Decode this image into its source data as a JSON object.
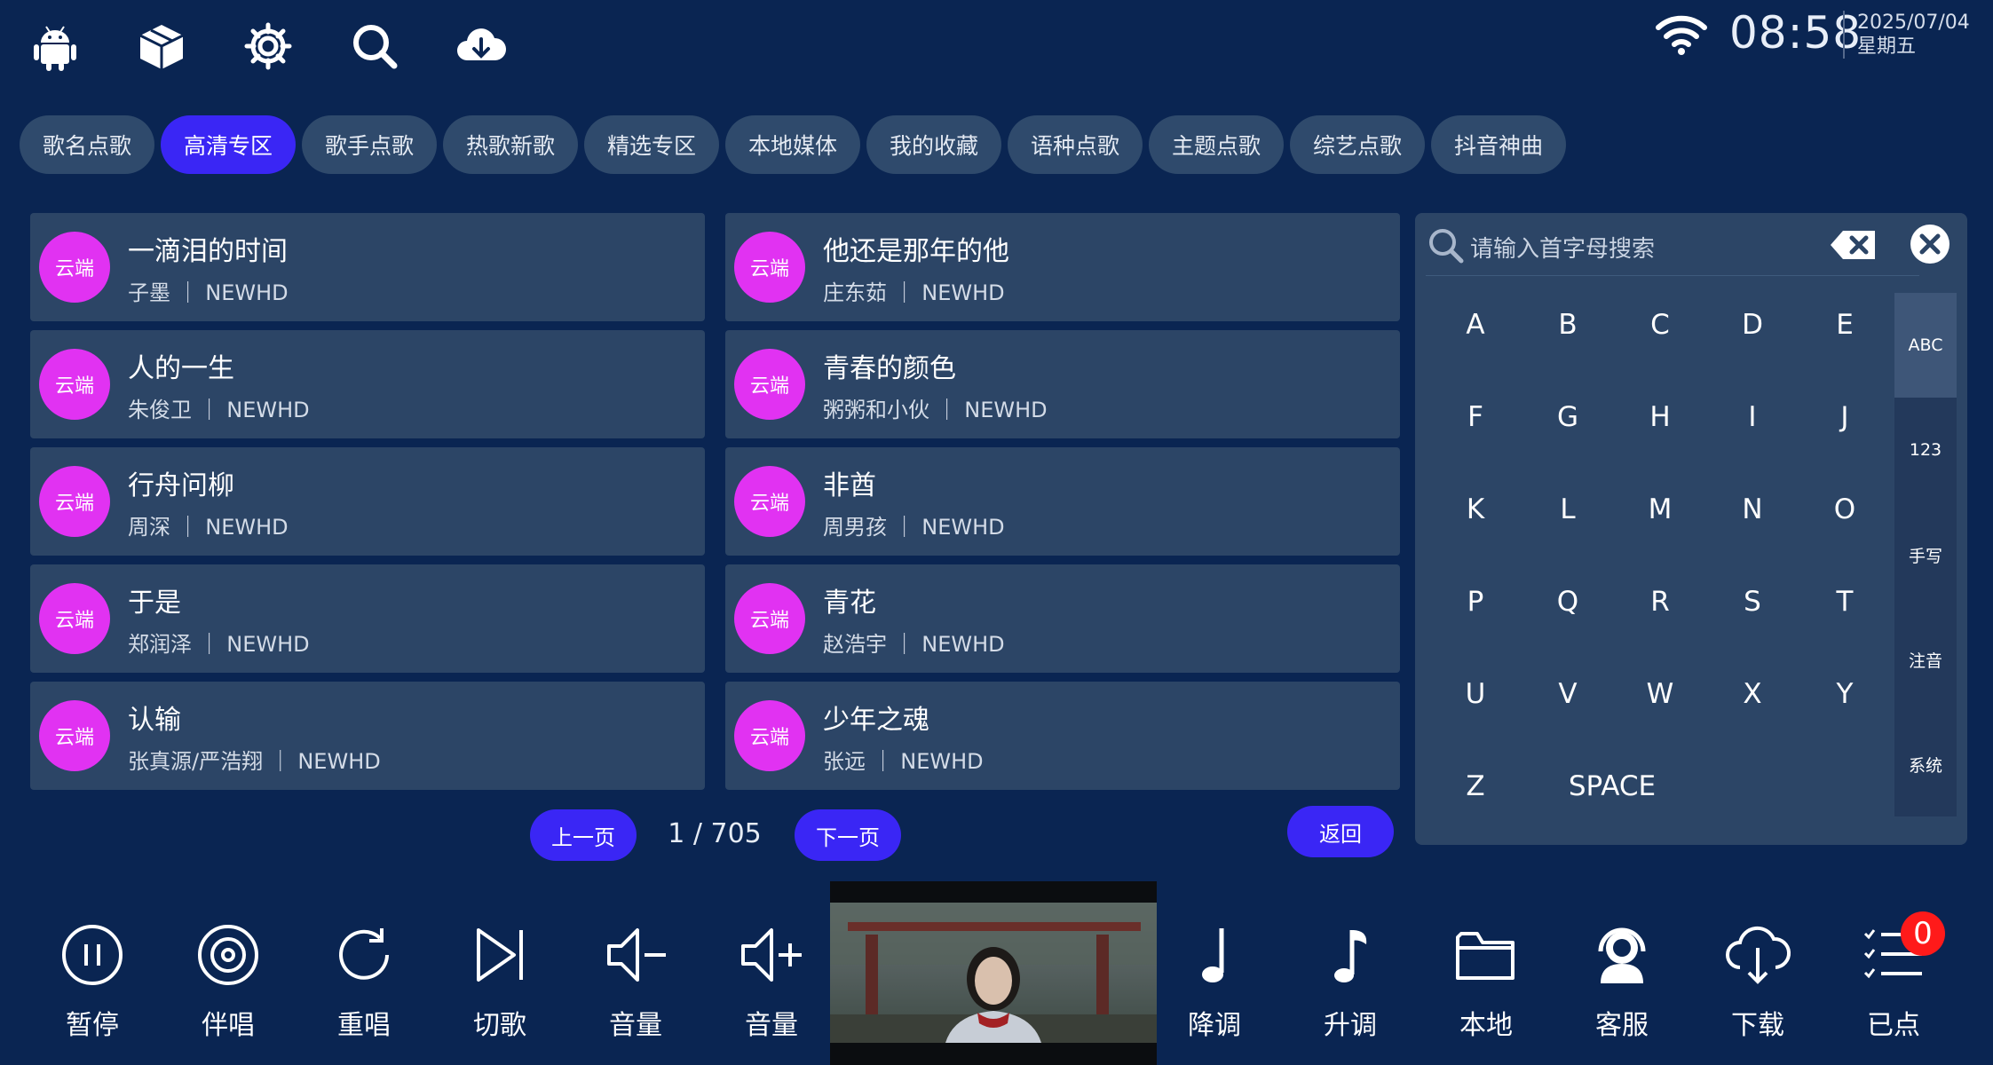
{
  "status_bar": {
    "time": "08:58",
    "date": "2025/07/04",
    "weekday": "星期五",
    "icons": [
      "android-icon",
      "box-icon",
      "gear-icon",
      "search-icon",
      "cloud-download-icon",
      "wifi-icon"
    ]
  },
  "tabs": [
    {
      "label": "歌名点歌",
      "active": false
    },
    {
      "label": "高清专区",
      "active": true
    },
    {
      "label": "歌手点歌",
      "active": false
    },
    {
      "label": "热歌新歌",
      "active": false
    },
    {
      "label": "精选专区",
      "active": false
    },
    {
      "label": "本地媒体",
      "active": false
    },
    {
      "label": "我的收藏",
      "active": false
    },
    {
      "label": "语种点歌",
      "active": false
    },
    {
      "label": "主题点歌",
      "active": false
    },
    {
      "label": "综艺点歌",
      "active": false
    },
    {
      "label": "抖音神曲",
      "active": false
    }
  ],
  "songs": [
    {
      "badge": "云端",
      "title": "一滴泪的时间",
      "subtitle": "子墨 ｜ NEWHD"
    },
    {
      "badge": "云端",
      "title": "他还是那年的他",
      "subtitle": "庄东茹 ｜ NEWHD"
    },
    {
      "badge": "云端",
      "title": "人的一生",
      "subtitle": "朱俊卫 ｜ NEWHD"
    },
    {
      "badge": "云端",
      "title": "青春的颜色",
      "subtitle": "粥粥和小伙 ｜ NEWHD"
    },
    {
      "badge": "云端",
      "title": "行舟问柳",
      "subtitle": "周深 ｜ NEWHD"
    },
    {
      "badge": "云端",
      "title": "非酋",
      "subtitle": "周男孩 ｜ NEWHD"
    },
    {
      "badge": "云端",
      "title": "于是",
      "subtitle": "郑润泽 ｜ NEWHD"
    },
    {
      "badge": "云端",
      "title": "青花",
      "subtitle": "赵浩宇 ｜ NEWHD"
    },
    {
      "badge": "云端",
      "title": "认输",
      "subtitle": "张真源/严浩翔 ｜ NEWHD"
    },
    {
      "badge": "云端",
      "title": "少年之魂",
      "subtitle": "张远 ｜ NEWHD"
    }
  ],
  "pagination": {
    "prev_label": "上一页",
    "next_label": "下一页",
    "page_text": "1 / 705",
    "back_label": "返回"
  },
  "keyboard": {
    "placeholder": "请输入首字母搜索",
    "keys": [
      "A",
      "B",
      "C",
      "D",
      "E",
      "F",
      "G",
      "H",
      "I",
      "J",
      "K",
      "L",
      "M",
      "N",
      "O",
      "P",
      "Q",
      "R",
      "S",
      "T",
      "U",
      "V",
      "W",
      "X",
      "Y",
      "Z"
    ],
    "space_label": "SPACE",
    "modes": [
      {
        "label": "ABC",
        "active": true
      },
      {
        "label": "123",
        "active": false
      },
      {
        "label": "手写",
        "active": false
      },
      {
        "label": "注音",
        "active": false
      },
      {
        "label": "系统",
        "active": false
      }
    ]
  },
  "controls": [
    {
      "label": "暂停",
      "icon": "pause-icon"
    },
    {
      "label": "伴唱",
      "icon": "vinyl-icon"
    },
    {
      "label": "重唱",
      "icon": "replay-icon"
    },
    {
      "label": "切歌",
      "icon": "skip-next-icon"
    },
    {
      "label": "音量",
      "icon": "volume-down-icon"
    },
    {
      "label": "音量",
      "icon": "volume-up-icon"
    },
    {
      "label": "降调",
      "icon": "note-down-icon"
    },
    {
      "label": "升调",
      "icon": "note-up-icon"
    },
    {
      "label": "本地",
      "icon": "folder-icon"
    },
    {
      "label": "客服",
      "icon": "customer-service-icon"
    },
    {
      "label": "下载",
      "icon": "cloud-download-icon"
    },
    {
      "label": "已点",
      "icon": "playlist-icon"
    }
  ],
  "queued_count": "0",
  "colors": {
    "background": "#0a2552",
    "panel": "#2c4566",
    "accent": "#3a26f5",
    "badge": "#e132f2",
    "alert": "#ff1a1a"
  }
}
